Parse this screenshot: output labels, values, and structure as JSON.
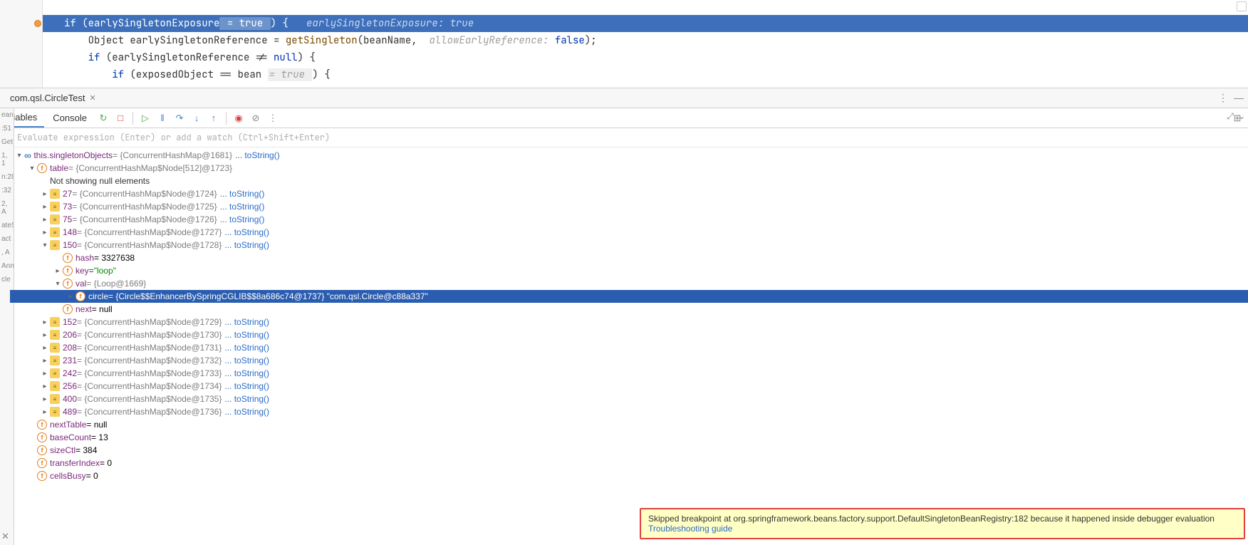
{
  "editor": {
    "lines": [
      {
        "prefix": "if (",
        "var": "earlySingletonExposure",
        "lit": " = true ",
        "suffix": ") {",
        "hint": "   earlySingletonExposure: true"
      },
      {
        "text1": "    Object earlySingletonReference = ",
        "fn": "getSingleton",
        "text2": "(beanName,  ",
        "hint": "allowEarlyReference:",
        "bool": " false",
        "text3": ");"
      },
      {
        "text": "    if (earlySingletonReference != null) {"
      },
      {
        "text1": "        if (exposedObject == bean ",
        "lit": "= true ",
        "text2": ") {"
      }
    ]
  },
  "tab": {
    "title": "com.qsl.CircleTest"
  },
  "toolbar": {
    "variables": "riables",
    "console": "Console"
  },
  "eval": {
    "placeholder": "Evaluate expression (Enter) or add a watch (Ctrl+Shift+Enter)"
  },
  "tree": {
    "root": {
      "name": "this.singletonObjects",
      "val": " = {ConcurrentHashMap@1681}",
      "link": " ... toString()"
    },
    "table": {
      "name": "table",
      "val": " = {ConcurrentHashMap$Node[512]@1723}"
    },
    "nullmsg": "Not showing null elements",
    "nodes": [
      {
        "idx": "27",
        "val": " = {ConcurrentHashMap$Node@1724}",
        "link": " ... toString()"
      },
      {
        "idx": "73",
        "val": " = {ConcurrentHashMap$Node@1725}",
        "link": " ... toString()"
      },
      {
        "idx": "75",
        "val": " = {ConcurrentHashMap$Node@1726}",
        "link": " ... toString()"
      },
      {
        "idx": "148",
        "val": " = {ConcurrentHashMap$Node@1727}",
        "link": " ... toString()"
      },
      {
        "idx": "150",
        "val": " = {ConcurrentHashMap$Node@1728}",
        "link": " ... toString()",
        "expanded": true
      }
    ],
    "node150": {
      "hash": {
        "name": "hash",
        "val": " = 3327638"
      },
      "key": {
        "name": "key",
        "val": " = ",
        "str": "\"loop\""
      },
      "valrow": {
        "name": "val",
        "val": " = {Loop@1669}"
      },
      "circle": {
        "name": "circle",
        "val": " = {Circle$$EnhancerBySpringCGLIB$$8a686c74@1737} \"com.qsl.Circle@c88a337\""
      },
      "next": {
        "name": "next",
        "val": " = null"
      }
    },
    "nodes2": [
      {
        "idx": "152",
        "val": " = {ConcurrentHashMap$Node@1729}",
        "link": " ... toString()"
      },
      {
        "idx": "206",
        "val": " = {ConcurrentHashMap$Node@1730}",
        "link": " ... toString()"
      },
      {
        "idx": "208",
        "val": " = {ConcurrentHashMap$Node@1731}",
        "link": " ... toString()"
      },
      {
        "idx": "231",
        "val": " = {ConcurrentHashMap$Node@1732}",
        "link": " ... toString()"
      },
      {
        "idx": "242",
        "val": " = {ConcurrentHashMap$Node@1733}",
        "link": " ... toString()"
      },
      {
        "idx": "256",
        "val": " = {ConcurrentHashMap$Node@1734}",
        "link": " ... toString()"
      },
      {
        "idx": "400",
        "val": " = {ConcurrentHashMap$Node@1735}",
        "link": " ... toString()"
      },
      {
        "idx": "489",
        "val": " = {ConcurrentHashMap$Node@1736}",
        "link": " ... toString()"
      }
    ],
    "fields": [
      {
        "name": "nextTable",
        "val": " = null"
      },
      {
        "name": "baseCount",
        "val": " = 13"
      },
      {
        "name": "sizeCtl",
        "val": " = 384"
      },
      {
        "name": "transferIndex",
        "val": " = 0"
      },
      {
        "name": "cellsBusy",
        "val": " = 0"
      }
    ]
  },
  "sidebar": [
    "ean",
    ":51",
    "Get",
    "1, 1",
    "n:28",
    ":32",
    "2, A",
    "ateS",
    "act",
    ", A",
    "Ann",
    "cle"
  ],
  "notification": {
    "msg": "Skipped breakpoint at org.springframework.beans.factory.support.DefaultSingletonBeanRegistry:182 because it happened inside debugger evaluation",
    "link": "Troubleshooting guide"
  }
}
